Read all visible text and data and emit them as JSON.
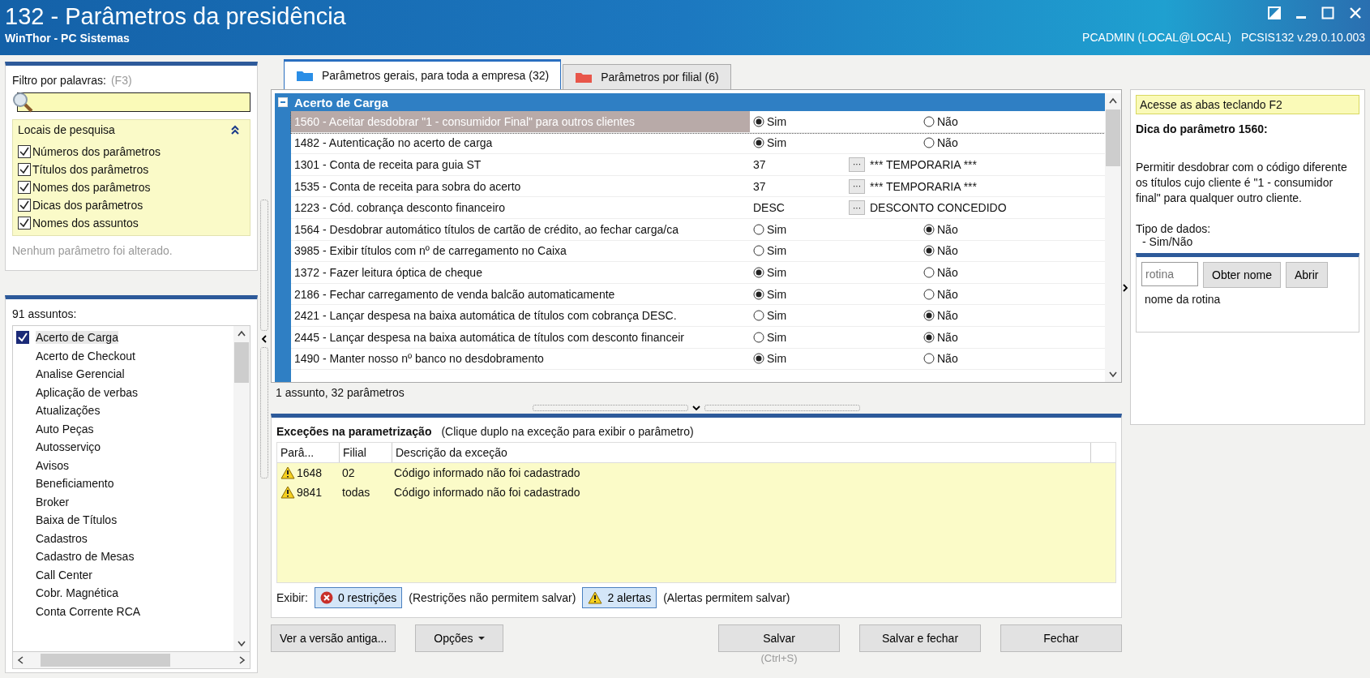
{
  "window": {
    "title": "132 - Parâmetros da presidência",
    "subtitle": "WinThor - PC Sistemas",
    "user": "PCADMIN (LOCAL@LOCAL)",
    "version": "PCSIS132  v.29.0.10.003"
  },
  "filter": {
    "label": "Filtro por palavras:",
    "shortcut": "(F3)",
    "search_places": {
      "title": "Locais de pesquisa",
      "expanded": true,
      "options": [
        {
          "label": "Números dos parâmetros",
          "checked": true
        },
        {
          "label": "Títulos dos parâmetros",
          "checked": true
        },
        {
          "label": "Nomes dos parâmetros",
          "checked": true
        },
        {
          "label": "Dicas dos parâmetros",
          "checked": true
        },
        {
          "label": "Nomes dos assuntos",
          "checked": true
        }
      ]
    },
    "status": "Nenhum parâmetro foi alterado."
  },
  "subjects": {
    "count_label": "91 assuntos:",
    "items": [
      {
        "label": "Acerto de Carga",
        "selected": true
      },
      {
        "label": "Acerto de Checkout",
        "selected": false
      },
      {
        "label": "Analise Gerencial",
        "selected": false
      },
      {
        "label": "Aplicação de verbas",
        "selected": false
      },
      {
        "label": "Atualizações",
        "selected": false
      },
      {
        "label": "Auto Peças",
        "selected": false
      },
      {
        "label": "Autosserviço",
        "selected": false
      },
      {
        "label": "Avisos",
        "selected": false
      },
      {
        "label": "Beneficiamento",
        "selected": false
      },
      {
        "label": "Broker",
        "selected": false
      },
      {
        "label": "Baixa de Títulos",
        "selected": false
      },
      {
        "label": "Cadastros",
        "selected": false
      },
      {
        "label": "Cadastro de Mesas",
        "selected": false
      },
      {
        "label": "Call Center",
        "selected": false
      },
      {
        "label": "Cobr. Magnética",
        "selected": false
      },
      {
        "label": "Conta Corrente RCA",
        "selected": false
      }
    ]
  },
  "tabs": [
    {
      "label": "Parâmetros gerais, para toda a empresa  (32)",
      "selected": true,
      "color": "#2a8ee6"
    },
    {
      "label": "Parâmetros por filial  (6)",
      "selected": false,
      "color": "#e8564a"
    }
  ],
  "group": {
    "title": "Acerto de Carga",
    "expanded": true
  },
  "parameters": [
    {
      "kind": "radio",
      "label": "1560 - Aceitar desdobrar \"1 - consumidor Final\" para outros clientes",
      "yes": "Sim",
      "no": "Não",
      "value": true,
      "selected": true
    },
    {
      "kind": "radio",
      "label": "1482 - Autenticação no acerto de carga",
      "yes": "Sim",
      "no": "Não",
      "value": true,
      "selected": false
    },
    {
      "kind": "lookup",
      "label": "1301 - Conta de receita para guia ST",
      "code": "37",
      "description": "*** TEMPORARIA ***",
      "button": "···",
      "selected": false
    },
    {
      "kind": "lookup",
      "label": "1535 - Conta de receita para sobra do acerto",
      "code": "37",
      "description": "*** TEMPORARIA ***",
      "button": "···",
      "selected": false
    },
    {
      "kind": "lookup",
      "label": "1223 - Cód. cobrança desconto financeiro",
      "code": "DESC",
      "description": "DESCONTO CONCEDIDO",
      "button": "···",
      "selected": false
    },
    {
      "kind": "radio",
      "label": "1564 - Desdobrar automático títulos de cartão de crédito, ao fechar carga/ca",
      "yes": "Sim",
      "no": "Não",
      "value": false,
      "selected": false
    },
    {
      "kind": "radio",
      "label": "3985 - Exibir títulos com nº de carregamento no Caixa",
      "yes": "Sim",
      "no": "Não",
      "value": false,
      "selected": false
    },
    {
      "kind": "radio",
      "label": "1372 - Fazer leitura óptica de cheque",
      "yes": "Sim",
      "no": "Não",
      "value": true,
      "selected": false
    },
    {
      "kind": "radio",
      "label": "2186 - Fechar carregamento de venda balcão automaticamente",
      "yes": "Sim",
      "no": "Não",
      "value": true,
      "selected": false
    },
    {
      "kind": "radio",
      "label": "2421 - Lançar despesa na baixa automática de títulos com cobrança DESC.",
      "yes": "Sim",
      "no": "Não",
      "value": false,
      "selected": false
    },
    {
      "kind": "radio",
      "label": "2445 - Lançar despesa na baixa automática de títulos com desconto financeir",
      "yes": "Sim",
      "no": "Não",
      "value": false,
      "selected": false
    },
    {
      "kind": "radio",
      "label": "1490 - Manter nosso nº banco no desdobramento",
      "yes": "Sim",
      "no": "Não",
      "value": true,
      "selected": false
    }
  ],
  "table_status": "1 assunto, 32 parâmetros",
  "hint": {
    "banner": "Acesse as abas teclando F2",
    "title": "Dica do parâmetro 1560:",
    "text": "Permitir desdobrar com o código diferente os títulos cujo cliente é \"1 - consumidor final\" para qualquer outro cliente.",
    "type_label": "Tipo de dados:",
    "type_value": "- Sim/Não"
  },
  "routine": {
    "placeholder": "rotina",
    "get_name_button": "Obter nome",
    "open_button": "Abrir",
    "name": "nome da rotina"
  },
  "exceptions": {
    "title": "Exceções na parametrização",
    "note": "(Clique duplo na exceção para exibir o parâmetro)",
    "columns": [
      "Parâ...",
      "Filial",
      "Descrição da exceção"
    ],
    "rows": [
      {
        "param": "1648",
        "branch": "02",
        "description": "Código informado não foi cadastrado"
      },
      {
        "param": "9841",
        "branch": "todas",
        "description": "Código informado não foi cadastrado"
      }
    ],
    "show_label": "Exibir:",
    "restrictions_button": "0 restrições",
    "restrictions_note": "(Restrições não permitem salvar)",
    "alerts_button": "2 alertas",
    "alerts_note": "(Alertas permitem salvar)"
  },
  "buttons": {
    "old_version": "Ver a versão antiga...",
    "options": "Opções",
    "save": "Salvar",
    "save_shortcut": "(Ctrl+S)",
    "save_close": "Salvar e fechar",
    "close": "Fechar"
  }
}
